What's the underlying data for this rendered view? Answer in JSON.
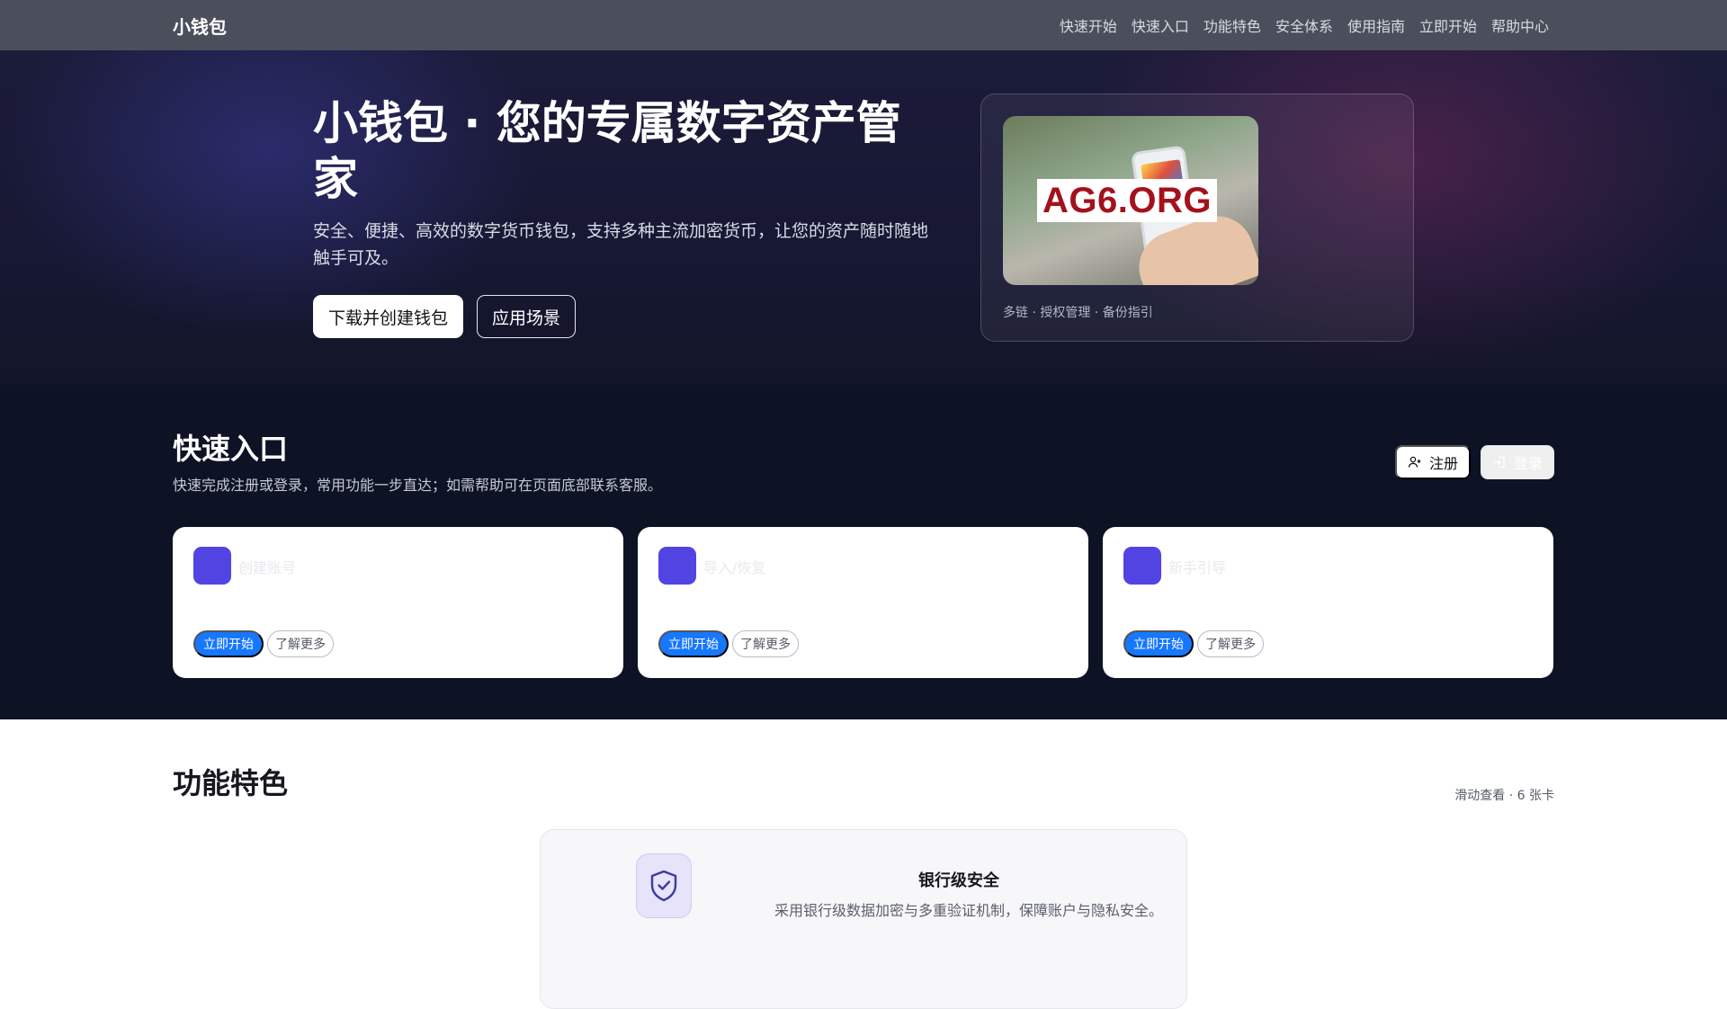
{
  "navbar": {
    "brand": "小钱包",
    "links": [
      "快速开始",
      "快速入口",
      "功能特色",
      "安全体系",
      "使用指南",
      "立即开始",
      "帮助中心"
    ]
  },
  "hero": {
    "title": "小钱包 · 您的专属数字资产管家",
    "subtitle": "安全、便捷、高效的数字货币钱包，支持多种主流加密货币，让您的资产随时随地触手可及。",
    "primary_button": "下载并创建钱包",
    "secondary_button": "应用场景",
    "image_overlay_text": "AG6.ORG",
    "card_caption": "多链 · 授权管理 · 备份指引"
  },
  "quick_entry": {
    "title": "快速入口",
    "subtitle": "快速完成注册或登录，常用功能一步直达；如需帮助可在页面底部联系客服。",
    "register_label": "注册",
    "login_label": "登录",
    "cards": [
      {
        "title": "创建账号",
        "start_label": "立即开始",
        "more_label": "了解更多"
      },
      {
        "title": "导入/恢复",
        "start_label": "立即开始",
        "more_label": "了解更多"
      },
      {
        "title": "新手引导",
        "start_label": "立即开始",
        "more_label": "了解更多"
      }
    ]
  },
  "features": {
    "title": "功能特色",
    "hint": "滑动查看 · 6 张卡",
    "card": {
      "icon": "shield-check-icon",
      "name": "银行级安全",
      "description": "采用银行级数据加密与多重验证机制，保障账户与隐私安全。"
    }
  },
  "colors": {
    "navbar_bg": "#4b4f5c",
    "hero_bg": "#171833",
    "quick_bg": "#0d1325",
    "accent_blue": "#1677ff",
    "icon_purple": "#5243e3"
  }
}
